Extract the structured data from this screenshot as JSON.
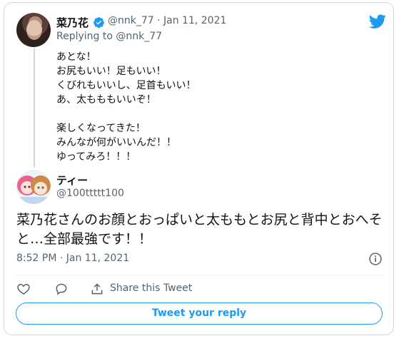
{
  "parent": {
    "display_name": "菜乃花",
    "meta": "@nnk_77 · Jan 11, 2021",
    "replying_prefix": "Replying to",
    "replying_handle": "@nnk_77",
    "text": "あとな！\nお尻もいい！足もいい！\nくびれもいいし、足首もいい！\nあ、太もももいいぞ！\n\n楽しくなってきた！\nみんなが何がいいんだ！！\nゆってみろ！！！"
  },
  "tweet": {
    "display_name": "ティー",
    "handle": "@100ttttt100",
    "text": "菜乃花さんのお顔とおっぱいと太ももとお尻と背中とおへそと…全部最強です！！",
    "timestamp": "8:52 PM · Jan 11, 2021"
  },
  "actions": {
    "share_label": "Share this Tweet",
    "reply_label": "Tweet your reply"
  },
  "colors": {
    "accent": "#1d9bf0",
    "secondary_text": "#536471"
  }
}
